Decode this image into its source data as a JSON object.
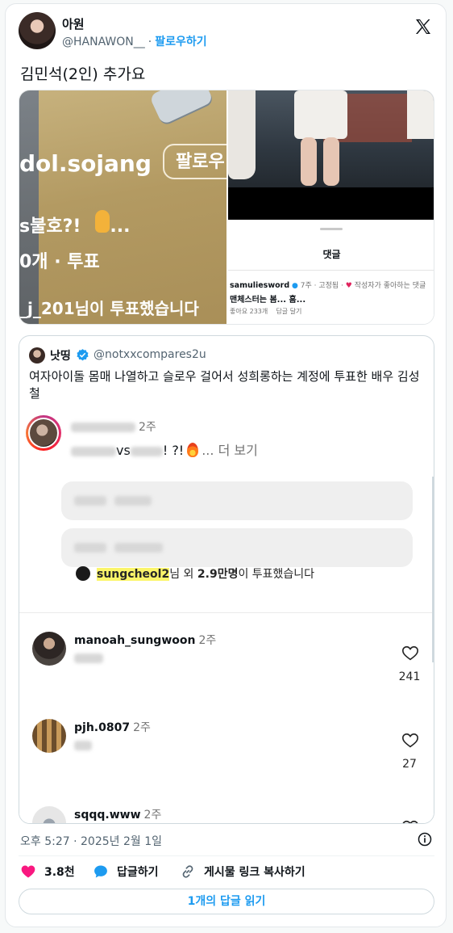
{
  "author": {
    "name": "아원",
    "handle": "@HANAWON__",
    "separator": "·",
    "follow_label": "팔로우하기"
  },
  "tweet_text": "김민석(2인) 추가요",
  "media_left": {
    "account": "dol.sojang",
    "follow_button": "팔로우",
    "line1": "s불호?!",
    "line1_suffix": "...",
    "line2": "0개 · 투표",
    "line3": "_j_201님이 투표했습니다"
  },
  "media_right": {
    "sheet_title": "댓글",
    "comment_user": "samuliesword",
    "comment_meta": "7주 · 고정됨 ·",
    "comment_tag": "작성자가 좋아하는 댓글",
    "comment_body": "맨체스터는 봄... 흠...",
    "likes": "좋아요 233개",
    "reply": "답글 달기"
  },
  "quote": {
    "name": "낫띵",
    "handle": "@notxxcompares2u",
    "text": "여자아이돌 몸매 나열하고 슬로우 걸어서 성희롱하는 계정에 투표한 배우 김성철",
    "post_time": "2주",
    "post_mid": "vs",
    "post_tail": "! ?!",
    "more": "... 더 보기",
    "voters_name": "sungcheol2",
    "voters_mid": "님 외 ",
    "voters_count": "2.9만명",
    "voters_tail": "이 투표했습니다",
    "comments": [
      {
        "user": "manoah_sungwoon",
        "time": "2주",
        "likes": "241"
      },
      {
        "user": "pjh.0807",
        "time": "2주",
        "likes": "27"
      },
      {
        "user": "sqqq.www",
        "time": "2주",
        "likes": ""
      }
    ]
  },
  "timestamp": "오후 5:27 · 2025년 2월 1일",
  "actions": {
    "like_count": "3.8천",
    "reply_label": "답글하기",
    "copy_label": "게시물 링크 복사하기"
  },
  "read_replies": "1개의 답글 읽기",
  "colors": {
    "accent": "#1d9bf0",
    "like": "#f91880",
    "highlight": "#fbf56a"
  }
}
